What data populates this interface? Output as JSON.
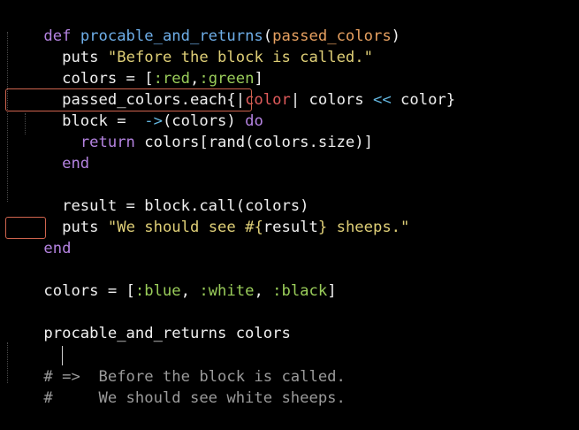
{
  "code": {
    "line1": {
      "kw": "def",
      "name": "procable_and_returns",
      "open": "(",
      "param": "passed_colors",
      "close": ")"
    },
    "line2": {
      "indent": "  ",
      "kw": "puts",
      "sp": " ",
      "str": "\"Before the block is called.\""
    },
    "line3": {
      "indent": "  ",
      "lhs": "colors = [",
      "sym1": ":red",
      "comma": ",",
      "sym2": ":green",
      "close": "]"
    },
    "line4": {
      "indent": "  ",
      "a": "passed_colors.each{",
      "p1": "|",
      "pv": "color",
      "p2": "|",
      "b": " colors ",
      "op": "<<",
      "c": " color}"
    },
    "line5": {
      "indent": "  ",
      "a": "block = ",
      "op": " ->",
      "b": "(colors) ",
      "kw": "do"
    },
    "line6": {
      "indent": "    ",
      "kw": "return",
      "rest": " colors[rand(colors.size)]"
    },
    "line7": {
      "indent": "  ",
      "kw": "end"
    },
    "line9": {
      "indent": "  ",
      "text": "result = block.call(colors)"
    },
    "line10": {
      "indent": "  ",
      "kw": "puts",
      "sp": " ",
      "str1": "\"We should see ",
      "interp": "#{",
      "mid": "result",
      "interp_close": "}",
      "str2": " sheeps.\""
    },
    "line11": {
      "kw": "end"
    },
    "line13": {
      "a": "colors = [",
      "s1": ":blue",
      "c1": ", ",
      "s2": ":white",
      "c2": ", ",
      "s3": ":black",
      "b": "]"
    },
    "line15": {
      "text": "procable_and_returns colors"
    },
    "line17": {
      "text": "# =>  Before the block is called."
    },
    "line18": {
      "text": "#     We should see white sheeps."
    }
  },
  "colors": {
    "background": "#000000",
    "keyword": "#b483e0",
    "function": "#6eaee8",
    "param": "#e6a060",
    "string": "#dfcf77",
    "symbol": "#9acd5a",
    "operator": "#64b7e0",
    "pipe_var": "#e05b5b",
    "comment": "#9a9a9a",
    "highlight_box": "#d0644e"
  }
}
